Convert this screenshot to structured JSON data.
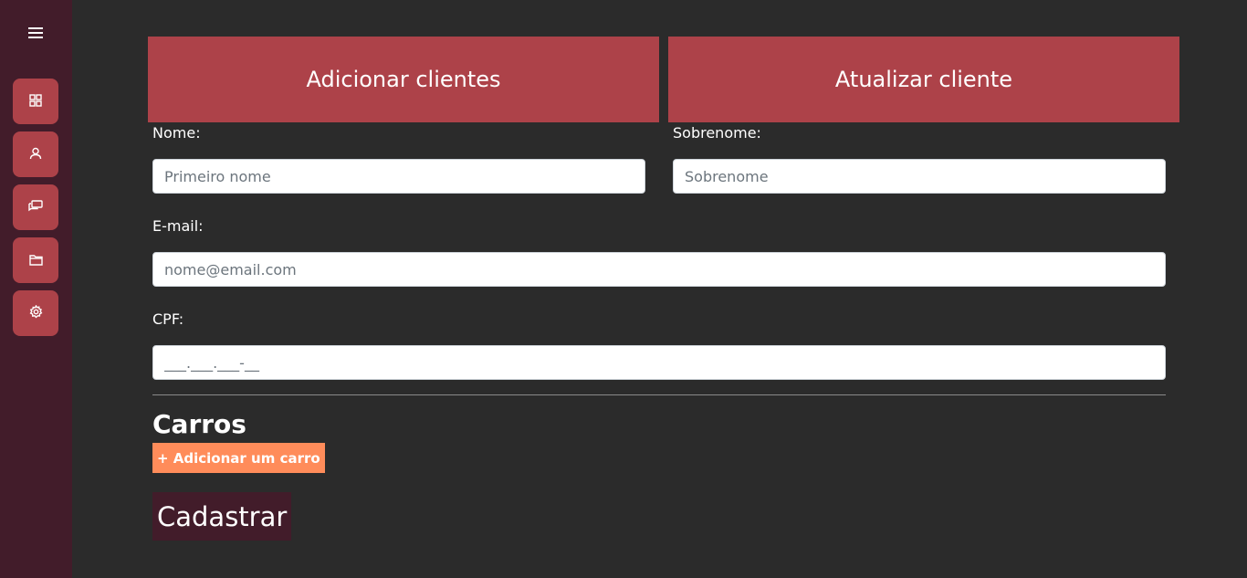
{
  "sidebar": {
    "menu_icon": "hamburger-icon",
    "items": [
      {
        "icon": "dashboard-grid-icon"
      },
      {
        "icon": "user-icon"
      },
      {
        "icon": "chat-icon"
      },
      {
        "icon": "folder-icon"
      },
      {
        "icon": "gear-icon"
      }
    ]
  },
  "tabs": [
    {
      "label": "Adicionar clientes"
    },
    {
      "label": "Atualizar cliente"
    }
  ],
  "form": {
    "first_name": {
      "label": "Nome:",
      "placeholder": "Primeiro nome",
      "value": ""
    },
    "last_name": {
      "label": "Sobrenome:",
      "placeholder": "Sobrenome",
      "value": ""
    },
    "email": {
      "label": "E-mail:",
      "placeholder": "nome@email.com",
      "value": ""
    },
    "cpf": {
      "label": "CPF:",
      "placeholder": "",
      "value": "___.___.___-__"
    }
  },
  "cars": {
    "title": "Carros",
    "add_button": "+ Adicionar um carro"
  },
  "submit_label": "Cadastrar",
  "colors": {
    "background": "#2b2b2b",
    "sidebar": "#421c2a",
    "accent": "#ad4249",
    "add_button": "#ff8c5a"
  }
}
